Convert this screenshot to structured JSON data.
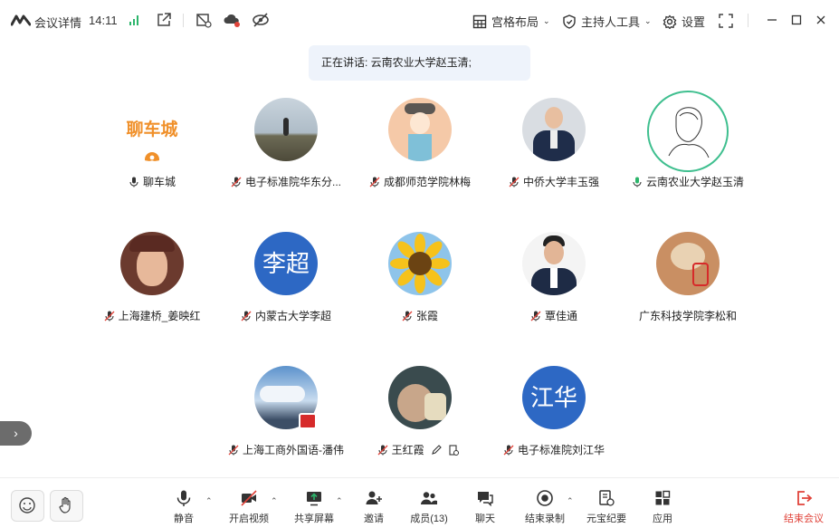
{
  "header": {
    "title": "会议详情",
    "time": "14:11",
    "layout_label": "宫格布局",
    "host_tools_label": "主持人工具",
    "settings_label": "设置"
  },
  "speaking": {
    "text": "正在讲话: 云南农业大学赵玉清;"
  },
  "participants": [
    {
      "name": "聊车城",
      "avatar_text": "聊车城"
    },
    {
      "name": "电子标准院华东分..."
    },
    {
      "name": "成都师范学院林梅"
    },
    {
      "name": "中侨大学丰玉强"
    },
    {
      "name": "云南农业大学赵玉清"
    },
    {
      "name": "上海建桥_姜映红"
    },
    {
      "name": "内蒙古大学李超",
      "avatar_text": "李超"
    },
    {
      "name": "张霞"
    },
    {
      "name": "覃佳通"
    },
    {
      "name": "广东科技学院李松和"
    },
    {
      "name": "上海工商外国语-潘伟"
    },
    {
      "name": "王红霞"
    },
    {
      "name": "电子标准院刘江华",
      "avatar_text": "江华"
    }
  ],
  "toolbar": {
    "mute": "静音",
    "video": "开启视频",
    "share": "共享屏幕",
    "invite": "邀请",
    "members": "成员(13)",
    "chat": "聊天",
    "end_record": "结束录制",
    "yuanbao": "元宝纪要",
    "apps": "应用",
    "end_meeting": "结束会议"
  },
  "colors": {
    "accent": "#2d68c4",
    "end": "#e0433a",
    "speaking_bg": "#eef3fb",
    "active_ring": "#3fbf8f"
  }
}
